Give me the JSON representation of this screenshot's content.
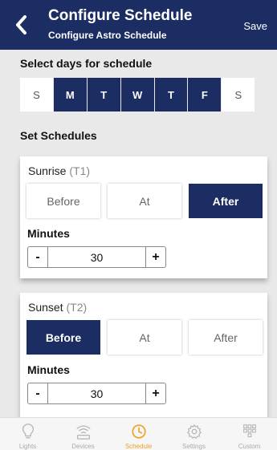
{
  "header": {
    "title": "Configure Schedule",
    "subtitle": "Configure Astro Schedule",
    "save_label": "Save"
  },
  "days_section": {
    "label": "Select days for schedule",
    "days": [
      {
        "label": "S",
        "selected": false
      },
      {
        "label": "M",
        "selected": true
      },
      {
        "label": "T",
        "selected": true
      },
      {
        "label": "W",
        "selected": true
      },
      {
        "label": "T",
        "selected": true
      },
      {
        "label": "F",
        "selected": true
      },
      {
        "label": "S",
        "selected": false
      }
    ]
  },
  "schedules_label": "Set Schedules",
  "sunrise": {
    "title": "Sunrise",
    "tag": "(T1)",
    "options": [
      "Before",
      "At",
      "After"
    ],
    "selected": "After",
    "minutes_label": "Minutes",
    "minus": "-",
    "plus": "+",
    "value": "30"
  },
  "sunset": {
    "title": "Sunset",
    "tag": "(T2)",
    "options": [
      "Before",
      "At",
      "After"
    ],
    "selected": "Before",
    "minutes_label": "Minutes",
    "minus": "-",
    "plus": "+",
    "value": "30"
  },
  "tabbar": {
    "items": [
      {
        "label": "Lights",
        "icon": "bulb-icon"
      },
      {
        "label": "Devices",
        "icon": "wifi-device-icon"
      },
      {
        "label": "Schedule",
        "icon": "clock-icon",
        "active": true
      },
      {
        "label": "Settings",
        "icon": "gear-icon"
      },
      {
        "label": "Custom",
        "icon": "grid-icon"
      }
    ]
  },
  "colors": {
    "primary": "#1b2d63",
    "accent": "#f0a020",
    "background": "#e9e9e9"
  }
}
